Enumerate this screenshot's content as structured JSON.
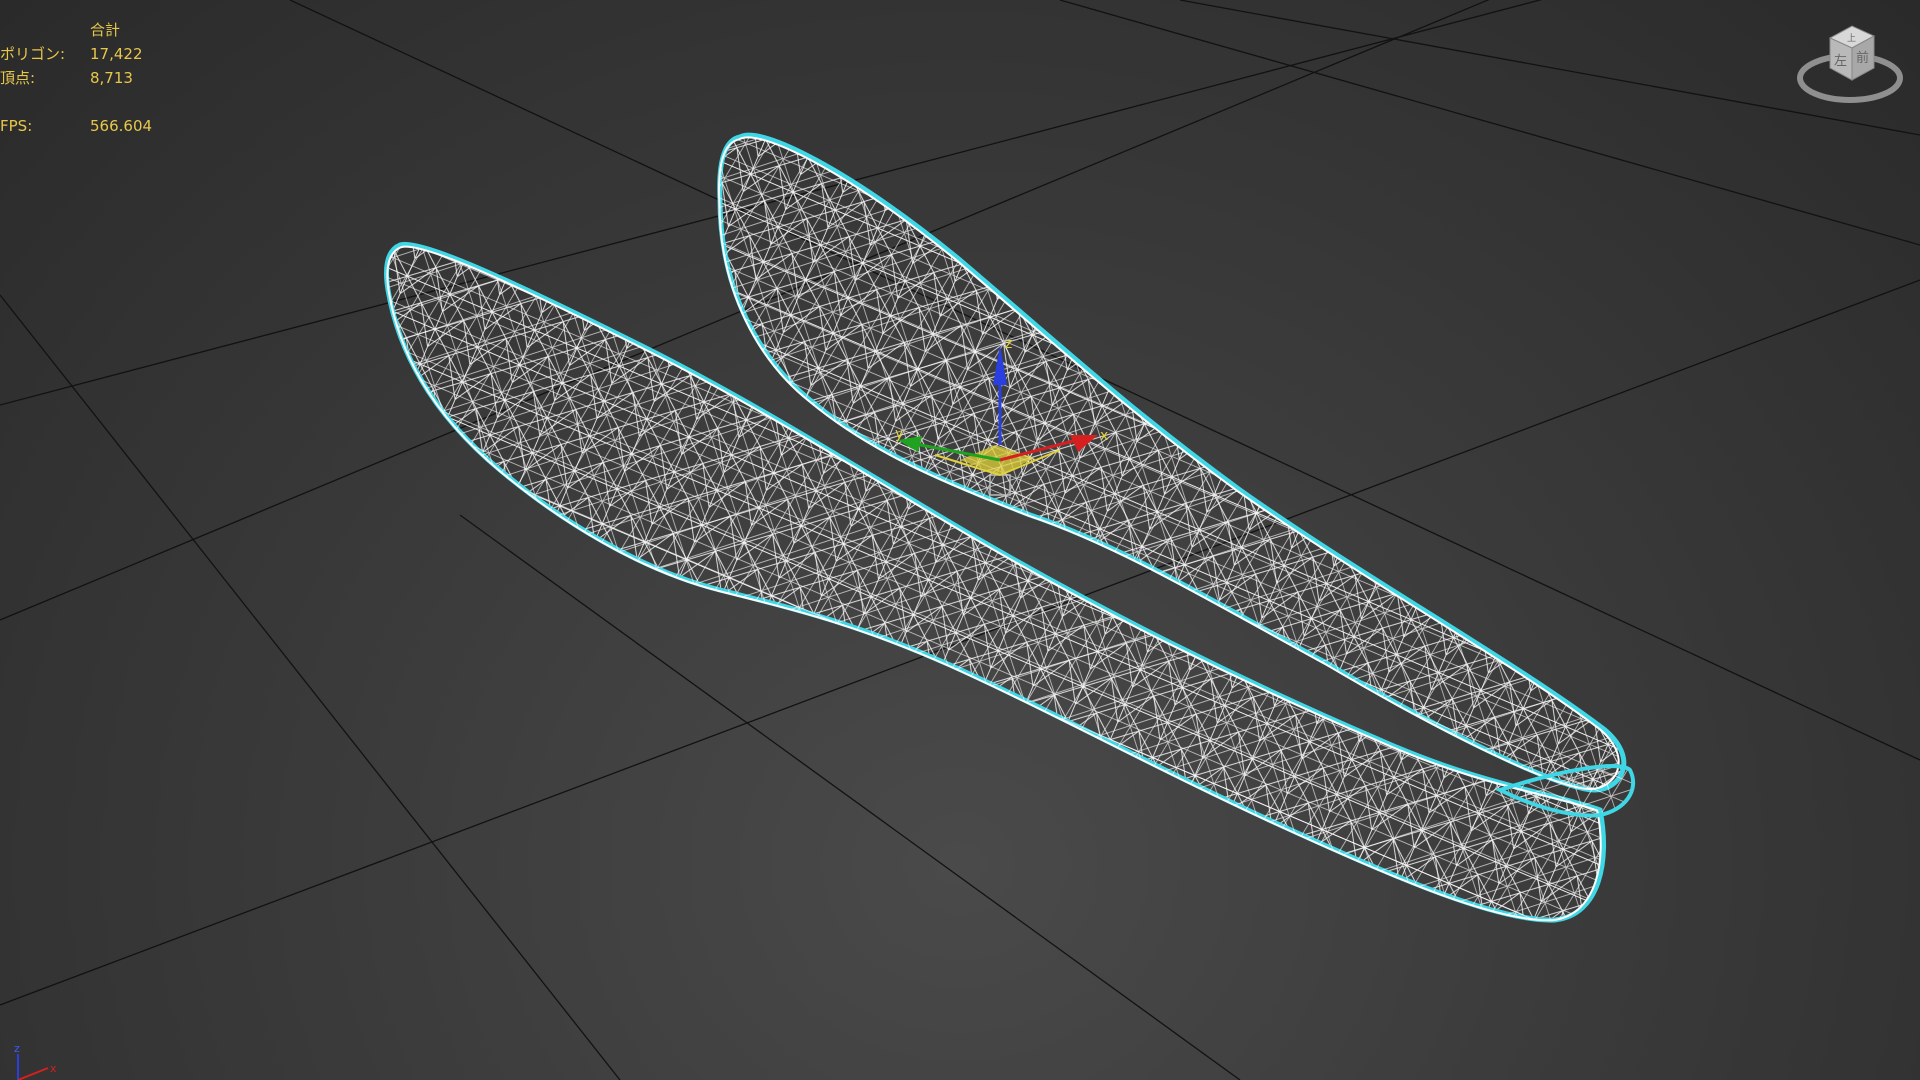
{
  "stats": {
    "header": "合計",
    "polygons_label": "ポリゴン:",
    "polygons_value": "17,422",
    "vertices_label": "頂点:",
    "vertices_value": "8,713",
    "fps_label": "FPS:",
    "fps_value": "566.604"
  },
  "viewcube": {
    "face_left": "左",
    "face_front": "前",
    "face_top": "上"
  },
  "gizmo": {
    "x_label": "x",
    "y_label": "y",
    "z_label": "z"
  },
  "axis_tripod": {
    "z_label": "z",
    "x_label": "x"
  },
  "colors": {
    "background": "#3a3a3a",
    "grid_line": "#111111",
    "stats_text": "#e8c84a",
    "selection_outline": "#3fd7e6",
    "wireframe": "#ffffff",
    "axis_x": "#d62020",
    "axis_y": "#1fa31f",
    "axis_z": "#2a3fe0"
  }
}
